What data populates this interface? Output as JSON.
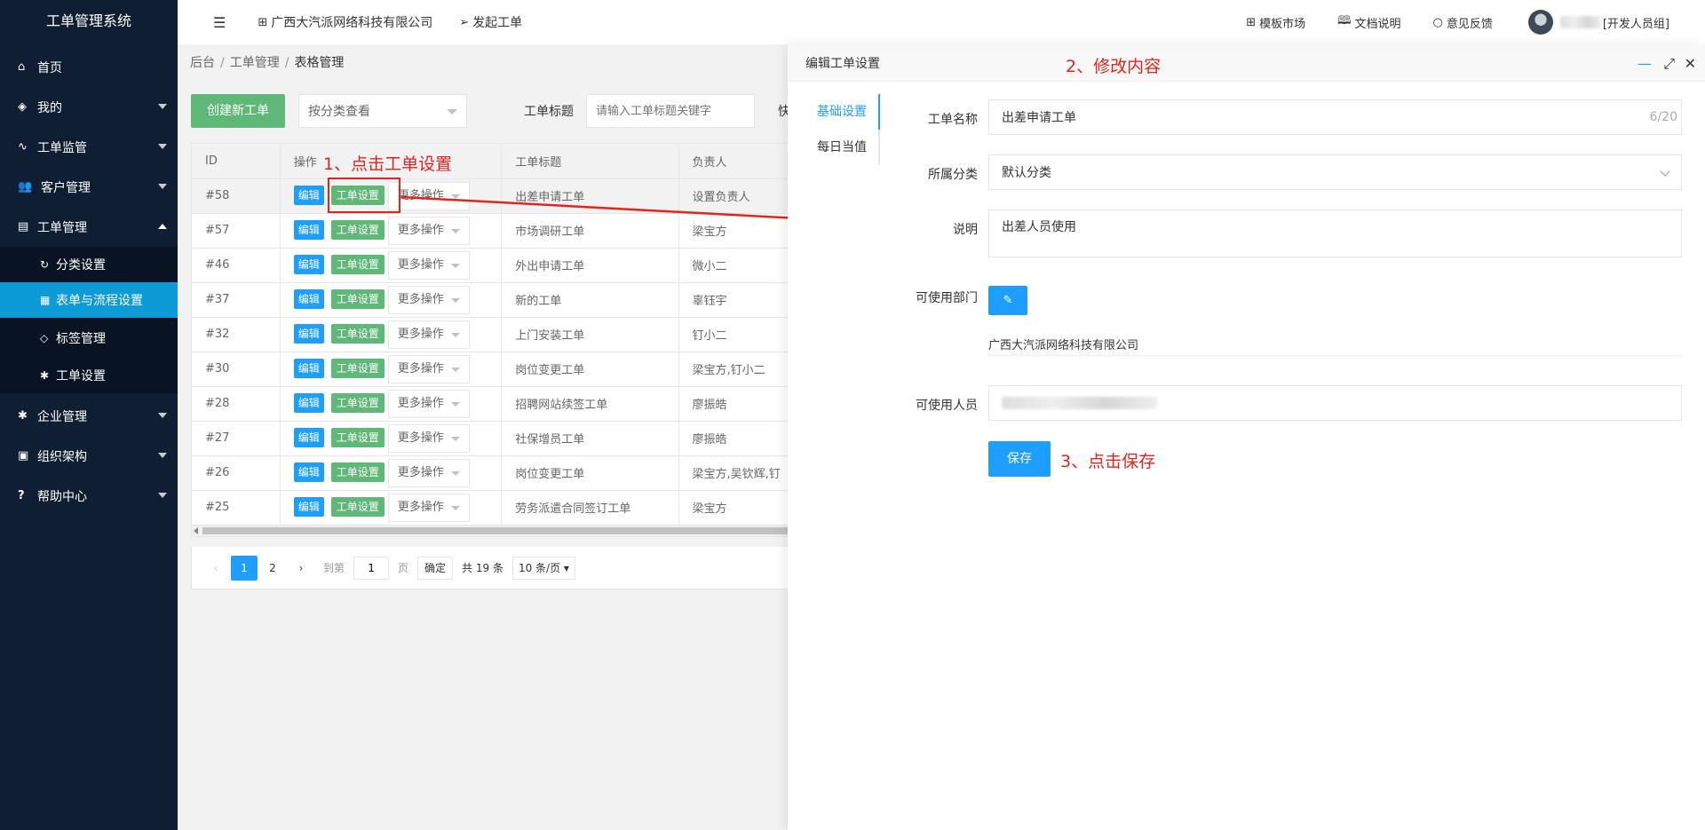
{
  "sidebar": {
    "title": "工单管理系统",
    "items": [
      {
        "label": "首页",
        "icon": "home-icon"
      },
      {
        "label": "我的",
        "icon": "layers-icon"
      },
      {
        "label": "工单监管",
        "icon": "pulse-icon"
      },
      {
        "label": "客户管理",
        "icon": "users-icon"
      },
      {
        "label": "工单管理",
        "icon": "clipboard-icon"
      }
    ],
    "sub_items": [
      {
        "label": "分类设置",
        "icon": "refresh-icon"
      },
      {
        "label": "表单与流程设置",
        "icon": "grid-icon"
      },
      {
        "label": "标签管理",
        "icon": "tag-icon"
      },
      {
        "label": "工单设置",
        "icon": "gear-icon"
      }
    ],
    "items_after": [
      {
        "label": "企业管理",
        "icon": "gear-icon"
      },
      {
        "label": "组织架构",
        "icon": "calendar-icon"
      },
      {
        "label": "帮助中心",
        "icon": "question-icon"
      }
    ]
  },
  "header": {
    "company": "广西大汽派网络科技有限公司",
    "create": "发起工单",
    "template_market": "模板市场",
    "docs": "文档说明",
    "feedback": "意见反馈",
    "user_role": "[开发人员组]"
  },
  "breadcrumb": [
    "后台",
    "工单管理",
    "表格管理"
  ],
  "toolbar": {
    "create_btn": "创建新工单",
    "category_select": "按分类查看",
    "title_label": "工单标题",
    "title_placeholder": "请输入工单标题关键字",
    "quick_label": "快"
  },
  "table": {
    "headers": [
      "ID",
      "操作",
      "工单标题",
      "负责人"
    ],
    "edit_label": "编辑",
    "settings_label": "工单设置",
    "more_label": "更多操作",
    "rows": [
      {
        "id": "#58",
        "title": "出差申请工单",
        "owner": "设置负责人"
      },
      {
        "id": "#57",
        "title": "市场调研工单",
        "owner": "梁宝方"
      },
      {
        "id": "#46",
        "title": "外出申请工单",
        "owner": "微小二"
      },
      {
        "id": "#37",
        "title": "新的工单",
        "owner": "辜钰宇"
      },
      {
        "id": "#32",
        "title": "上门安装工单",
        "owner": "钉小二"
      },
      {
        "id": "#30",
        "title": "岗位变更工单",
        "owner": "梁宝方,钉小二"
      },
      {
        "id": "#28",
        "title": "招聘网站续签工单",
        "owner": "廖振皓"
      },
      {
        "id": "#27",
        "title": "社保增员工单",
        "owner": "廖振皓"
      },
      {
        "id": "#26",
        "title": "岗位变更工单",
        "owner": "梁宝方,吴钦辉,钉"
      },
      {
        "id": "#25",
        "title": "劳务派遣合同签订工单",
        "owner": "梁宝方"
      }
    ]
  },
  "pager": {
    "pages": [
      "1",
      "2"
    ],
    "goto": "到第",
    "page_value": "1",
    "page_unit": "页",
    "confirm": "确定",
    "total": "共 19 条",
    "size": "10 条/页"
  },
  "annotations": {
    "step1": "1、点击工单设置",
    "step2": "2、修改内容",
    "step3": "3、点击保存"
  },
  "drawer": {
    "title": "编辑工单设置",
    "tabs": [
      "基础设置",
      "每日当值"
    ],
    "name_label": "工单名称",
    "name_value": "出差申请工单",
    "name_count": "6/20",
    "category_label": "所属分类",
    "category_value": "默认分类",
    "desc_label": "说明",
    "desc_value": "出差人员使用",
    "dept_label": "可使用部门",
    "dept_value": "广西大汽派网络科技有限公司",
    "users_label": "可使用人员",
    "save_btn": "保存"
  },
  "colors": {
    "sidebar_bg": "#0f1e33",
    "active_blue": "#0d9bd8",
    "primary_blue": "#1e9fff",
    "green": "#5fb878",
    "annotation_red": "#e4241c"
  }
}
